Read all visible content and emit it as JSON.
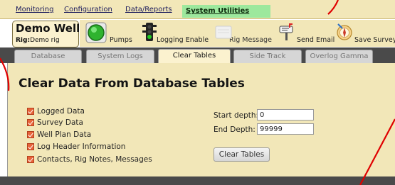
{
  "menu": {
    "items": [
      "Monitoring",
      "Configuration",
      "Data/Reports",
      "System Utilities"
    ],
    "active_index": 3
  },
  "rig": {
    "name": "Demo Well",
    "rig_label": "Rig:",
    "rig_value": "Demo rig"
  },
  "toolbar": {
    "pumps": "Pumps",
    "logging_enable": "Logging Enable",
    "rig_message": "Rig Message",
    "send_email": "Send Email",
    "save_survey": "Save Survey"
  },
  "tabs": [
    "Database",
    "System Logs",
    "Clear Tables",
    "Side Track",
    "Overlog Gamma"
  ],
  "active_tab": "Clear Tables",
  "panel": {
    "title": "Clear Data From Database Tables",
    "checkboxes": [
      {
        "label": "Logged Data",
        "checked": true
      },
      {
        "label": "Survey Data",
        "checked": true
      },
      {
        "label": "Well Plan Data",
        "checked": true
      },
      {
        "label": "Log Header Information",
        "checked": true
      },
      {
        "label": "Contacts, Rig Notes, Messages",
        "checked": true
      }
    ],
    "start_depth_label": "Start depth:",
    "start_depth_value": "0",
    "end_depth_label": "End Depth:",
    "end_depth_value": "99999",
    "clear_button": "Clear Tables"
  },
  "colors": {
    "panel_bg": "#f2e7b8",
    "active_menu": "#9de89d",
    "checkbox": "#e8643a",
    "tab_strip": "#4a4a4a",
    "annotation": "#e00000"
  }
}
